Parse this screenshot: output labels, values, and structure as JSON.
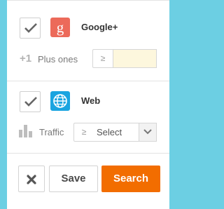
{
  "colors": {
    "background": "#6ccfe3",
    "google": "#ec6a5a",
    "web": "#1aa4e0",
    "search_button": "#f26d00"
  },
  "services": [
    {
      "title": "Google+",
      "icon": "google-g-icon",
      "checked": true,
      "metric": {
        "icon": "plus-one-icon",
        "icon_text": "+1",
        "label": "Plus ones",
        "operator": "≥",
        "value": ""
      }
    },
    {
      "title": "Web",
      "icon": "globe-icon",
      "checked": true,
      "metric": {
        "icon": "bar-chart-icon",
        "label": "Traffic",
        "operator": "≥",
        "select_value": "Select"
      }
    }
  ],
  "actions": {
    "clear_icon": "close-icon",
    "save_label": "Save",
    "search_label": "Search"
  }
}
